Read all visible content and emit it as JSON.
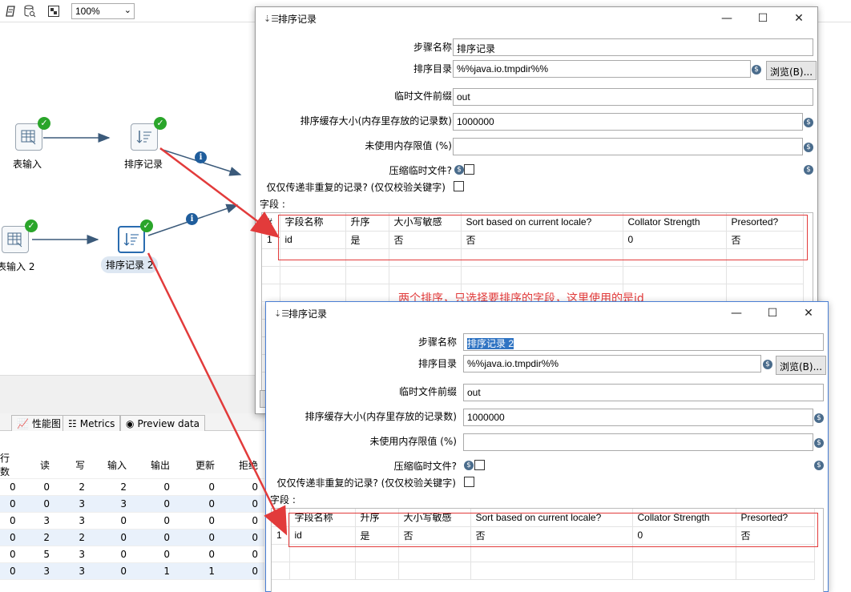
{
  "toolbar": {
    "zoom": "100%"
  },
  "canvas": {
    "nodes": [
      {
        "label": "表输入"
      },
      {
        "label": "排序记录"
      },
      {
        "label": "表输入 2"
      },
      {
        "label": "排序记录 2"
      }
    ]
  },
  "bottom": {
    "tabs": [
      "性能图",
      "Metrics",
      "Preview data"
    ],
    "headers": [
      "行数",
      "读",
      "写",
      "输入",
      "输出",
      "更新",
      "拒绝"
    ],
    "rows": [
      [
        "0",
        "0",
        "2",
        "2",
        "0",
        "0",
        "0"
      ],
      [
        "0",
        "0",
        "3",
        "3",
        "0",
        "0",
        "0"
      ],
      [
        "0",
        "3",
        "3",
        "0",
        "0",
        "0",
        "0"
      ],
      [
        "0",
        "2",
        "2",
        "0",
        "0",
        "0",
        "0"
      ],
      [
        "0",
        "5",
        "3",
        "0",
        "0",
        "0",
        "0"
      ],
      [
        "0",
        "3",
        "3",
        "0",
        "1",
        "1",
        "0"
      ]
    ]
  },
  "dialog1": {
    "title": "排序记录",
    "labels": {
      "step_name": "步骤名称",
      "sort_dir": "排序目录",
      "tmp_prefix": "临时文件前缀",
      "buffer": "排序缓存大小(内存里存放的记录数)",
      "free_mem": "未使用内存限值 (%)",
      "compress": "压缩临时文件?",
      "unique": "仅仅传递非重复的记录? (仅仅校验关键字)",
      "fields": "字段 :"
    },
    "values": {
      "step_name": "排序记录",
      "sort_dir": "%%java.io.tmpdir%%",
      "tmp_prefix": "out",
      "buffer": "1000000",
      "free_mem": ""
    },
    "browse": "浏览(B)...",
    "columns": [
      "#",
      "字段名称",
      "升序",
      "大小写敏感",
      "Sort based on current locale?",
      "Collator Strength",
      "Presorted?"
    ],
    "rows": [
      [
        "1",
        "id",
        "是",
        "否",
        "否",
        "0",
        "否"
      ]
    ]
  },
  "dialog2": {
    "title": "排序记录",
    "labels": {
      "step_name": "步骤名称",
      "sort_dir": "排序目录",
      "tmp_prefix": "临时文件前缀",
      "buffer": "排序缓存大小(内存里存放的记录数)",
      "free_mem": "未使用内存限值 (%)",
      "compress": "压缩临时文件?",
      "unique": "仅仅传递非重复的记录? (仅仅校验关键字)",
      "fields": "字段 :"
    },
    "values": {
      "step_name": "排序记录 2",
      "sort_dir": "%%java.io.tmpdir%%",
      "tmp_prefix": "out",
      "buffer": "1000000",
      "free_mem": ""
    },
    "browse": "浏览(B)...",
    "columns": [
      "#",
      "字段名称",
      "升序",
      "大小写敏感",
      "Sort based on current locale?",
      "Collator Strength",
      "Presorted?"
    ],
    "rows": [
      [
        "1",
        "id",
        "是",
        "否",
        "否",
        "0",
        "否"
      ]
    ]
  },
  "annotation": "两个排序，只选择要排序的字段，这里使用的是id",
  "colors": {
    "annotation_red": "#e23b3b",
    "success_green": "#2aa52a",
    "info_blue": "#1f5d9c"
  }
}
